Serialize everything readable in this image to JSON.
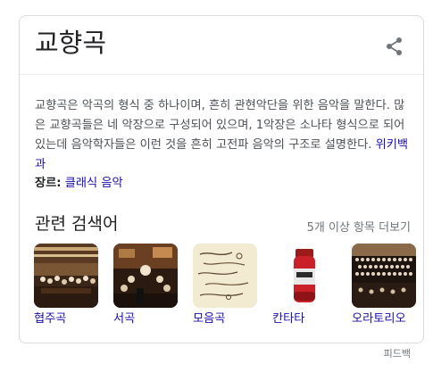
{
  "panel": {
    "title": "교향곡",
    "share_icon": "share-icon",
    "description": "교향곡은 악곡의 형식 중 하나이며, 흔히 관현악단을 위한 음악을 말한다. 많은 교향곡들은 네 악장으로 구성되어 있으며, 1악장은 소나타 형식으로 되어 있는데 음악학자들은 이런 것을 흔히 고전파 음악의 구조로 설명한다.",
    "source_link": "위키백과",
    "genre_label": "장르:",
    "genre_value": "클래식 음악"
  },
  "related": {
    "title": "관련 검색어",
    "more_label": "5개 이상 항목 더보기",
    "items": [
      {
        "label": "협주곡"
      },
      {
        "label": "서곡"
      },
      {
        "label": "모음곡"
      },
      {
        "label": "칸타타"
      },
      {
        "label": "오라토리오"
      }
    ]
  },
  "footer": {
    "feedback_label": "피드백"
  },
  "colors": {
    "link": "#1a0dab",
    "text": "#4d5156",
    "muted": "#70757a",
    "border": "#dadce0"
  }
}
